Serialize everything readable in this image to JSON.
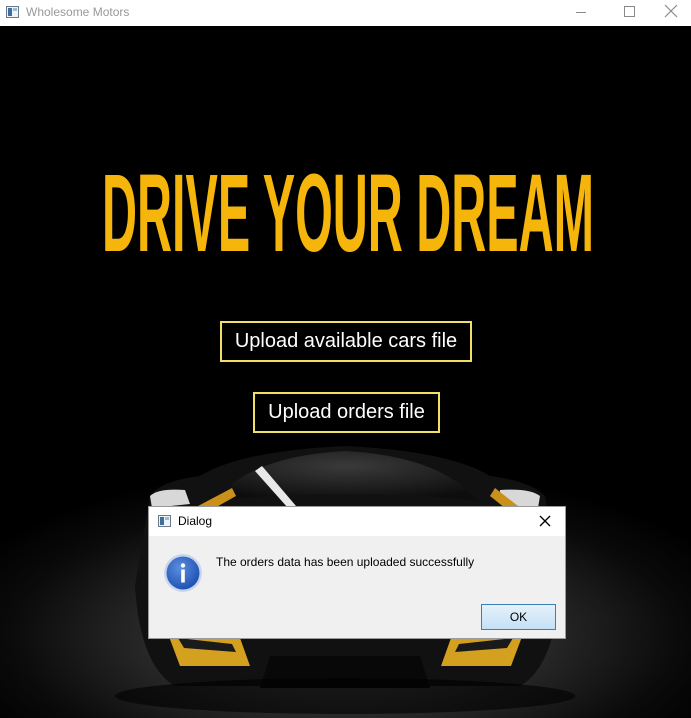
{
  "window": {
    "title": "Wholesome Motors",
    "controls": [
      "minimize",
      "maximize",
      "close"
    ]
  },
  "hero": {
    "headline": "Drive your dream",
    "headline_color": "#f5b50b",
    "upload_cars_label": "Upload available cars file",
    "upload_orders_label": "Upload orders file",
    "button_border_color": "#f2e066"
  },
  "dialog": {
    "title": "Dialog",
    "message": "The orders data has been uploaded successfully",
    "ok_label": "OK",
    "icon": "info-icon"
  }
}
